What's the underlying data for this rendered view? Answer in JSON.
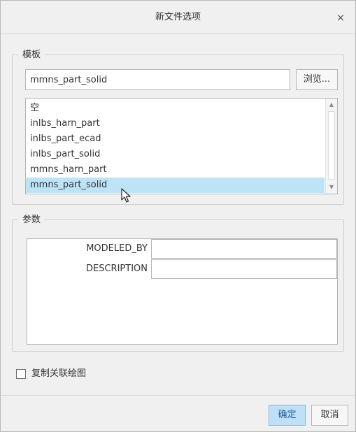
{
  "dialog": {
    "title": "新文件选项",
    "close_symbol": "×"
  },
  "template": {
    "legend": "模板",
    "input_value": "mmns_part_solid",
    "browse_label": "浏览...",
    "items": [
      {
        "label": "空",
        "selected": false
      },
      {
        "label": "inlbs_harn_part",
        "selected": false
      },
      {
        "label": "inlbs_part_ecad",
        "selected": false
      },
      {
        "label": "inlbs_part_solid",
        "selected": false
      },
      {
        "label": "mmns_harn_part",
        "selected": false
      },
      {
        "label": "mmns_part_solid",
        "selected": true
      }
    ],
    "scroll_up_symbol": "▲",
    "scroll_down_symbol": "▼"
  },
  "params": {
    "legend": "参数",
    "rows": [
      {
        "name": "MODELED_BY",
        "value": ""
      },
      {
        "name": "DESCRIPTION",
        "value": ""
      }
    ]
  },
  "copy_drawing": {
    "label": "复制关联绘图",
    "checked": false
  },
  "buttons": {
    "ok_label": "确定",
    "cancel_label": "取消"
  },
  "colors": {
    "selection": "#bde3f7",
    "ok_button": "#bfe0f7",
    "dialog_bg": "#f0f0f0"
  }
}
